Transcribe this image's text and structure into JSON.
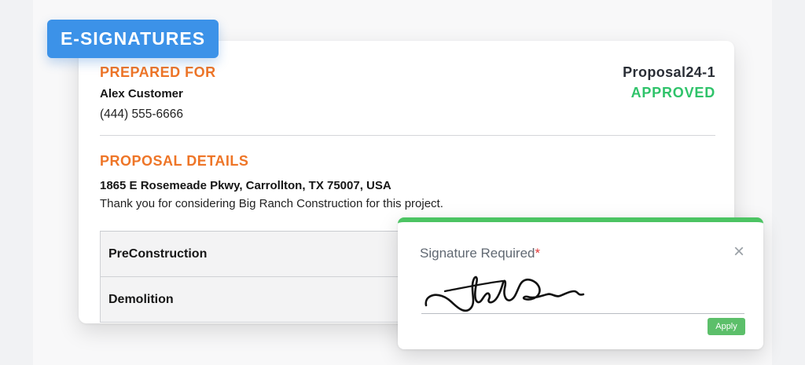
{
  "badge": {
    "label": "E-SIGNATURES"
  },
  "prepared_for": {
    "title": "PREPARED FOR",
    "customer_name": "Alex Customer",
    "phone": "(444) 555-6666"
  },
  "proposal": {
    "id": "Proposal24-1",
    "status": "APPROVED"
  },
  "details": {
    "title": "PROPOSAL DETAILS",
    "address": "1865 E Rosemeade Pkwy, Carrollton, TX 75007, USA",
    "message": "Thank you for considering Big Ranch Construction for this project."
  },
  "line_items": [
    {
      "label": "PreConstruction"
    },
    {
      "label": "Demolition"
    }
  ],
  "signature": {
    "title": "Signature Required",
    "required_mark": "*",
    "close_icon": "×",
    "apply_label": "Apply"
  },
  "colors": {
    "accent_orange": "#ee7527",
    "approved_green": "#2fc36a",
    "badge_blue": "#3c92e8",
    "panel_green": "#4cc463"
  }
}
